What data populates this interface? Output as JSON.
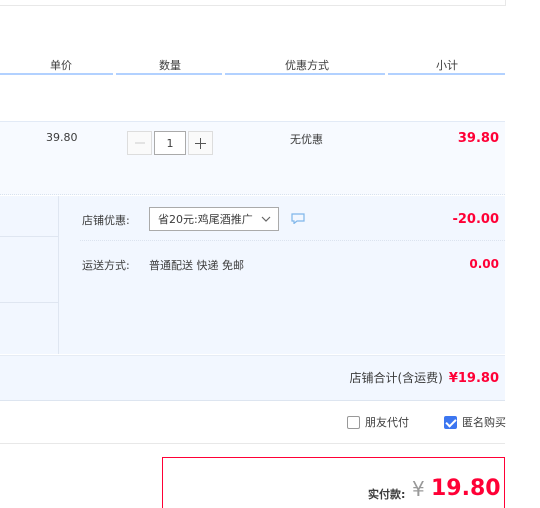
{
  "header": {
    "unit_price": "单价",
    "quantity": "数量",
    "promotion": "优惠方式",
    "subtotal": "小计"
  },
  "item": {
    "price": "39.80",
    "quantity": "1",
    "promotion": "无优惠",
    "subtotal": "39.80"
  },
  "shop": {
    "discount_label": "店铺优惠:",
    "discount_selected": "省20元:鸡尾酒推广",
    "discount_amount": "-20.00",
    "shipping_label": "运送方式:",
    "shipping_value": "普通配送 快递 免邮",
    "shipping_amount": "0.00",
    "total_label": "店铺合计(含运费)",
    "total_value": "¥19.80"
  },
  "options": {
    "friend_pay": "朋友代付",
    "friend_pay_checked": false,
    "anonymous": "匿名购买",
    "anonymous_checked": true
  },
  "payment": {
    "label": "实付款:",
    "currency": "¥",
    "amount": "19.80"
  },
  "colors": {
    "accent_red": "#ff0036",
    "header_line": "#b2d1ff",
    "row_bg": "#f2f7ff",
    "checkbox_blue": "#3c76f0"
  }
}
